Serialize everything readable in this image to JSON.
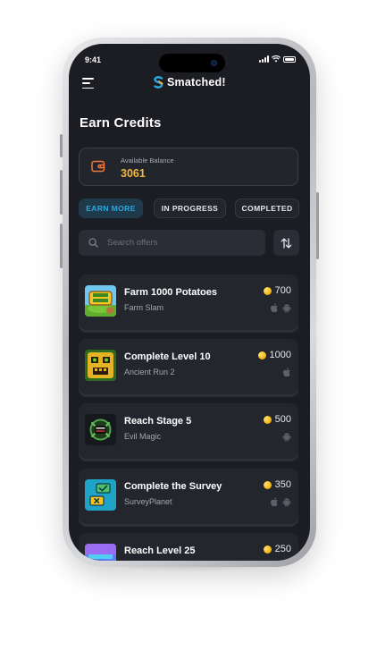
{
  "status_bar": {
    "time": "9:41"
  },
  "header": {
    "app_name": "Smatched!"
  },
  "page": {
    "title": "Earn Credits"
  },
  "balance": {
    "label": "Available Balance",
    "value": "3061"
  },
  "tabs": [
    {
      "label": "EARN MORE",
      "active": true
    },
    {
      "label": "IN PROGRESS",
      "active": false
    },
    {
      "label": "COMPLETED",
      "active": false
    }
  ],
  "search": {
    "placeholder": "Search offers",
    "value": ""
  },
  "offers": [
    {
      "title": "Farm 1000 Potatoes",
      "subtitle": "Farm Slam",
      "reward": "700",
      "platforms": [
        "apple-icon",
        "android-icon"
      ]
    },
    {
      "title": "Complete Level 10",
      "subtitle": "Ancient Run 2",
      "reward": "1000",
      "platforms": [
        "apple-icon"
      ]
    },
    {
      "title": "Reach Stage 5",
      "subtitle": "Evil Magic",
      "reward": "500",
      "platforms": [
        "android-icon"
      ]
    },
    {
      "title": "Complete the Survey",
      "subtitle": "SurveyPlanet",
      "reward": "350",
      "platforms": [
        "apple-icon",
        "android-icon"
      ]
    },
    {
      "title": "Reach Level 25",
      "subtitle": "",
      "reward": "250",
      "platforms": []
    }
  ],
  "colors": {
    "background": "#1b1d23",
    "card": "#23262d",
    "accent_blue": "#29a9e0",
    "balance_gold": "#f2b63c",
    "wallet_icon": "#f0763a"
  }
}
